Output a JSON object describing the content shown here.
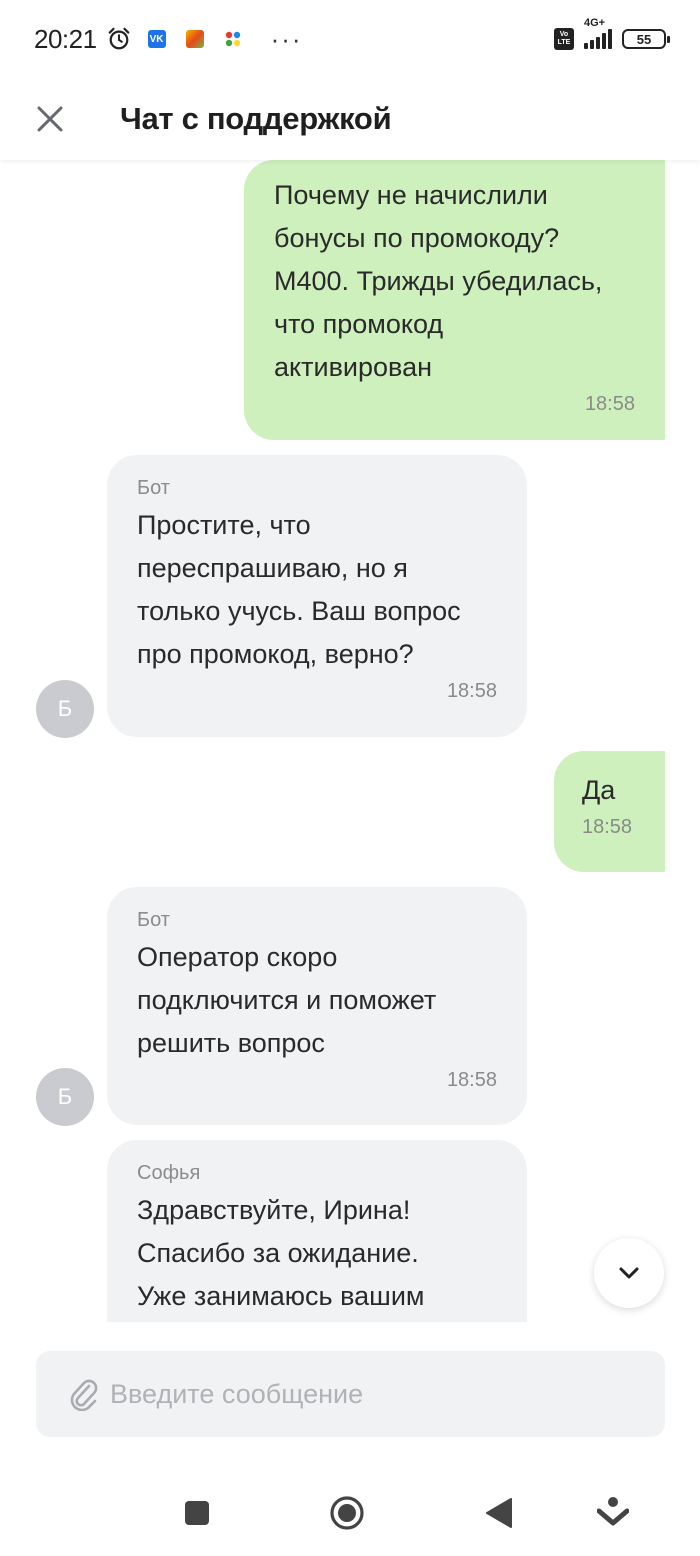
{
  "status_bar": {
    "time": "20:21",
    "vk_label": "VK",
    "volte_top": "Vo",
    "volte_bottom": "LTE",
    "network": "4G+",
    "battery": "55"
  },
  "header": {
    "title": "Чат с поддержкой"
  },
  "messages": [
    {
      "direction": "out",
      "text": "Почему не начислили\nбонусы по промокоду?\nМ400. Трижды убедилась,\nчто промокод\nактивирован",
      "time": "18:58"
    },
    {
      "direction": "in",
      "sender": "Бот",
      "avatar": "Б",
      "text": "Простите, что\nпереспрашиваю, но я\nтолько учусь. Ваш вопрос\nпро промокод, верно?",
      "time": "18:58"
    },
    {
      "direction": "out",
      "text": "Да",
      "time": "18:58"
    },
    {
      "direction": "in",
      "sender": "Бот",
      "avatar": "Б",
      "text": "Оператор скоро\nподключится и поможет\nрешить вопрос",
      "time": "18:58"
    },
    {
      "direction": "in",
      "sender": "Софья",
      "text": "Здравствуйте, Ирина!\nСпасибо за ожидание.\nУже занимаюсь вашим"
    }
  ],
  "composer": {
    "placeholder": "Введите сообщение",
    "value": ""
  },
  "icons": {
    "close": "close-icon",
    "attach": "paperclip-icon",
    "scroll_down": "chevron-down-icon",
    "alarm": "alarm-icon",
    "nav_recents": "square-icon",
    "nav_home": "circle-icon",
    "nav_back": "triangle-back-icon",
    "nav_assistant": "assistant-icon"
  },
  "colors": {
    "outgoing_bubble": "#cdf0bd",
    "incoming_bubble": "#f1f2f4",
    "avatar": "#c9cbd0"
  }
}
